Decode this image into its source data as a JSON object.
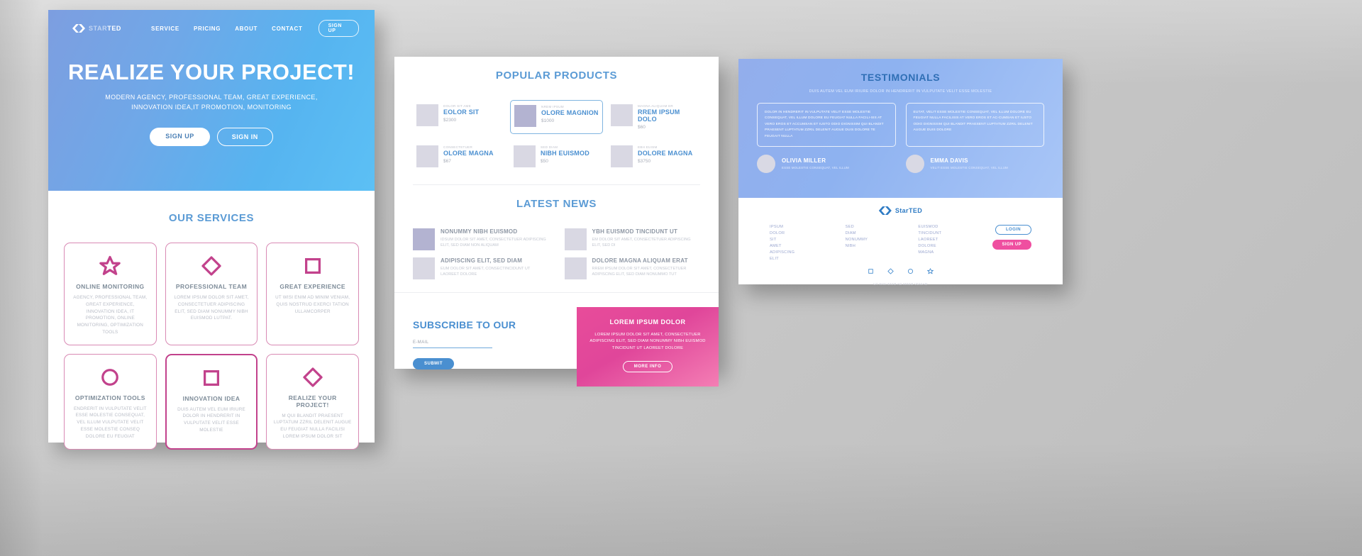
{
  "left": {
    "nav": {
      "logo_dim": "STAR",
      "logo_bold": "TED",
      "links": [
        "SERVICE",
        "PRICING",
        "ABOUT",
        "CONTACT"
      ],
      "cta": "SIGN UP"
    },
    "hero": {
      "title": "REALIZE YOUR PROJECT!",
      "subtitle_line1": "MODERN AGENCY, PROFESSIONAL TEAM, GREAT EXPERIENCE,",
      "subtitle_line2": "INNOVATION IDEA,IT PROMOTION, MONITORING",
      "btn_primary": "SIGN UP",
      "btn_secondary": "SIGN IN"
    },
    "services": {
      "title": "OUR SERVICES",
      "cards": [
        {
          "icon": "star-icon",
          "name": "ONLINE MONITORING",
          "desc": "AGENCY, PROFESSIONAL TEAM, GREAT EXPERIENCE, INNOVATION IDEA, IT PROMOTION, ONLINE MONITORING, OPTIMIZATION TOOLS",
          "accent": false
        },
        {
          "icon": "diamond-icon",
          "name": "PROFESSIONAL TEAM",
          "desc": "LOREM IPSUM DOLOR SIT AMET, CONSECTETUER ADIPISCING ELIT, SED DIAM NONUMMY NIBH EUISMOD LUTPAT.",
          "accent": false
        },
        {
          "icon": "square-icon",
          "name": "GREAT EXPERIENCE",
          "desc": "UT WISI ENIM AD MINIM VENIAM, QUIS NOSTRUD EXERCI TATION ULLAMCORPER",
          "accent": false
        },
        {
          "icon": "circle-icon",
          "name": "OPTIMIZATION TOOLS",
          "desc": "ENDRERIT IN VULPUTATE VELIT ESSE MOLESTIE CONSEQUAT, VEL ILLUM VULPUTATE VELIT ESSE MOLESTIE CONSEQ DOLORE EU FEUGIAT",
          "accent": false
        },
        {
          "icon": "square-icon",
          "name": "INNOVATION IDEA",
          "desc": "DUIS AUTEM VEL EUM IRIURE DOLOR IN HENDRERIT IN VULPUTATE VELIT ESSE MOLESTIE",
          "accent": true
        },
        {
          "icon": "diamond-icon",
          "name": "REALIZE YOUR PROJECT!",
          "desc": "M QUI BLANDIT PRAESENT LUPTATUM ZZRIL DELENIT AUGUE EU FEUGIAT NULLA FACILISI LOREM IPSUM DOLOR SIT",
          "accent": false
        }
      ]
    }
  },
  "middle": {
    "products": {
      "title": "POPULAR PRODUCTS",
      "items": [
        {
          "category": "DOLOR SIT AME",
          "name": "EOLOR SIT",
          "price": "$2300",
          "selected": false
        },
        {
          "category": "NREM IPSUM",
          "name": "OLORE MAGNION",
          "price": "$1000",
          "selected": true
        },
        {
          "category": "MAGNA ALIQUAM ER",
          "name": "RREM IPSUM DOLO",
          "price": "$60",
          "selected": false
        },
        {
          "category": "CONSECTETUER",
          "name": "OLORE MAGNA",
          "price": "$67",
          "selected": false
        },
        {
          "category": "SED DIAM",
          "name": "NIBH EUISMOD",
          "price": "$50",
          "selected": false
        },
        {
          "category": "EBH EUISM",
          "name": "DOLORE MAGNA",
          "price": "$3750",
          "selected": false
        }
      ]
    },
    "news": {
      "title": "LATEST NEWS",
      "items": [
        {
          "title": "NONUMMY NIBH EUISMOD",
          "desc": "IDSUM DOLOR SIT AMET, CONSECTETUER ADIPISCING ELIT, SED DIAM NON ALIQUAM",
          "dark": true
        },
        {
          "title": "YBH EUISMOD TINCIDUNT UT",
          "desc": "EM DOLOR SIT AMET, CONSECTETUER ADIPISCING ELIT, SED DI",
          "dark": false
        },
        {
          "title": "ADIPISCING ELIT, SED DIAM",
          "desc": "EUM DOLOR SIT AMET, CONSECTINCIDUNT UT LAOREET DOLORE",
          "dark": false
        },
        {
          "title": "DOLORE MAGNA ALIQUAM ERAT",
          "desc": "RREM IPSUM DOLOR SIT AMET, CONSECTETUER ADIPISCING ELIT, SED DIAM NONUMMO TUT",
          "dark": false
        }
      ]
    },
    "subscribe": {
      "title": "SUBSCRIBE TO OUR",
      "field_label": "E-MAIL",
      "button": "SUBMIT"
    },
    "promo": {
      "title": "LOREM IPSUM DOLOR",
      "desc": "LOREM IPSUM DOLOR SIT AMET, CONSECTETUER ADIPISCING ELIT, SED DIAM NONUMMY NIBH EUISMOD TINCIDUNT UT LAOREET DOLORE",
      "button": "MORE INFO"
    }
  },
  "right": {
    "testimonials": {
      "title": "TESTIMONIALS",
      "subtitle": "DUIS AUTEM VEL EUM IRIURE DOLOR IN HENDRERIT IN VULPUTATE VELIT ESSE MOLESTIE",
      "quotes": [
        "DOLOR IN HENDRERIT IN VULPUTATE VELIT ESSE MOLESTIE CONSEQUAT, VEL ILLUM DOLORE EU FEUGIAT NULLA FACILI-SIS AT VERO EROS ET ACCUMSAN ET IUSTO ODIO DIGNISSIM QUI BLANDIT PRAESENT LUPTATUM ZZRIL DELENIT AUGUE DUIS DOLORE TE FEUGAIT NULLA",
        "EUTAT, VELIT ESSE MOLESTIE CONSEQUAT, VEL ILLUM DOLORE EU FEUGIAT NULLA FACILISIS AT VERO EROS ET AC-CUMSAN ET IUSTO ODIO DIGNISSIM QUI BLANDIT PRAESENT LUPTATUM ZZRIL DELENIT AUGUE DUIS DOLORE"
      ],
      "authors": [
        {
          "name": "OLIVIA MILLER",
          "role": "ESSE MOLESTIE CONSEQUAT, VEL ILLUM"
        },
        {
          "name": "EMMA DAVIS",
          "role": "VELIT ESSE MOLESTIE CONSEQUAT, VEL ILLUM"
        }
      ]
    },
    "footer": {
      "logo_dim": "Star",
      "logo_bold": "TED",
      "columns": [
        [
          "IPSUM",
          "DOLOR",
          "SIT",
          "AMET",
          "ADIPISCING",
          "ELIT"
        ],
        [
          "SED",
          "DIAM",
          "NONUMMY",
          "NIBH"
        ],
        [
          "EUISMOD",
          "TINCIDUNT",
          "LAOREET",
          "DOLORE",
          "MAGNA"
        ]
      ],
      "login": "LOGIN",
      "signup": "SIGN UP",
      "icons": [
        "square-icon",
        "diamond-icon",
        "circle-icon",
        "star-icon"
      ],
      "note": "UT WISI ENIM AD MINIM VENIAM"
    }
  },
  "colors": {
    "blue": "#4a8fd0",
    "pink": "#c2428c",
    "magenta": "#ef4fa0",
    "hero_blue": "#5cb4f0"
  }
}
